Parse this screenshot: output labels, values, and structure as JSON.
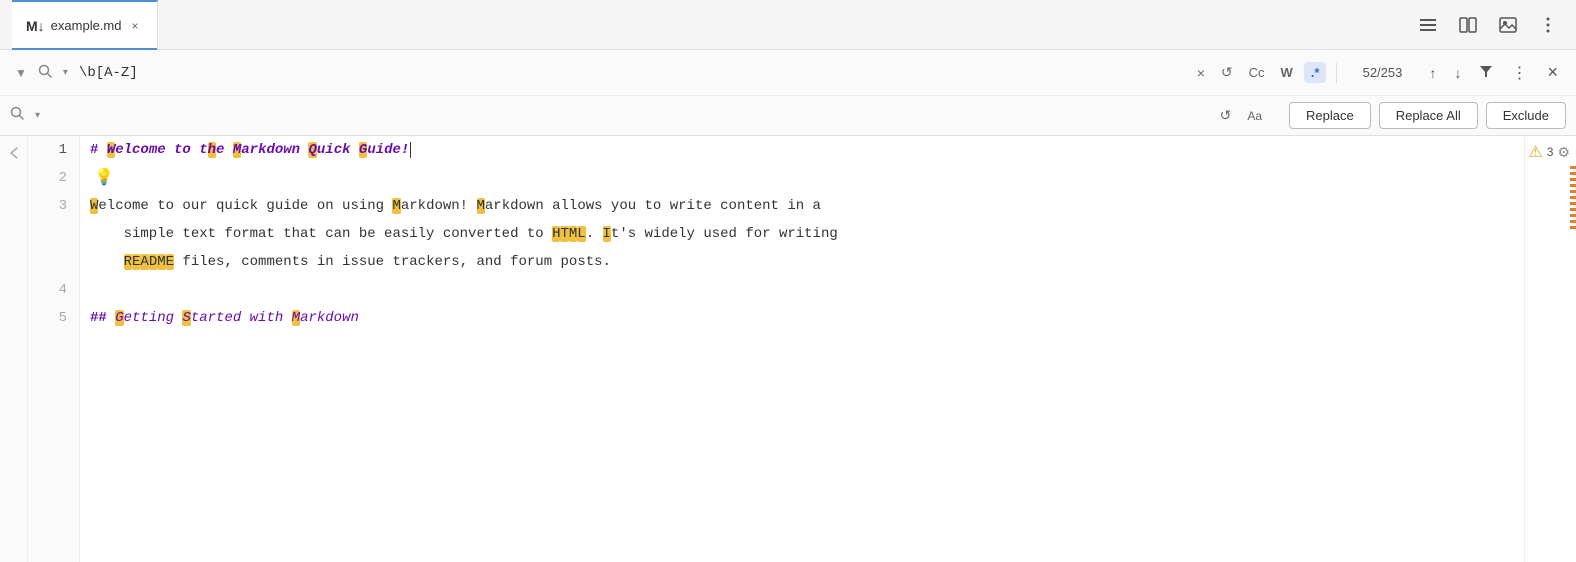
{
  "tab": {
    "filename": "example.md",
    "md_icon": "M↓",
    "close_label": "×"
  },
  "toolbar": {
    "layout_icon": "☰",
    "split_icon": "⊟",
    "image_icon": "🖼",
    "more_icon": "⋮"
  },
  "search": {
    "find_value": "\\b[A-Z]",
    "find_placeholder": "",
    "replace_placeholder": "",
    "match_count": "52/253",
    "cc_label": "Cc",
    "w_label": "W",
    "regex_label": ".*",
    "replace_label": "Replace",
    "replace_all_label": "Replace All",
    "exclude_label": "Exclude",
    "close_label": "×",
    "reset_label": "↺",
    "replace_reset_label": "↺",
    "case_aa_label": "Aa"
  },
  "editor": {
    "lines": [
      {
        "num": 1,
        "content": "# Welcome to the Markdown Quick Guide!"
      },
      {
        "num": 2,
        "content": ""
      },
      {
        "num": 3,
        "content": "Welcome to our quick guide on using Markdown! Markdown allows you to write content in a"
      },
      {
        "num": 3,
        "content": "    simple text format that can be easily converted to HTML. It's widely used for writing"
      },
      {
        "num": 3,
        "content": "    README files, comments in issue trackers, and forum posts."
      },
      {
        "num": 4,
        "content": ""
      },
      {
        "num": 5,
        "content": "## Getting Started with Markdown"
      }
    ],
    "gutter_warning": "⚠",
    "gutter_count": "3",
    "gutter_gear": "⚙"
  }
}
